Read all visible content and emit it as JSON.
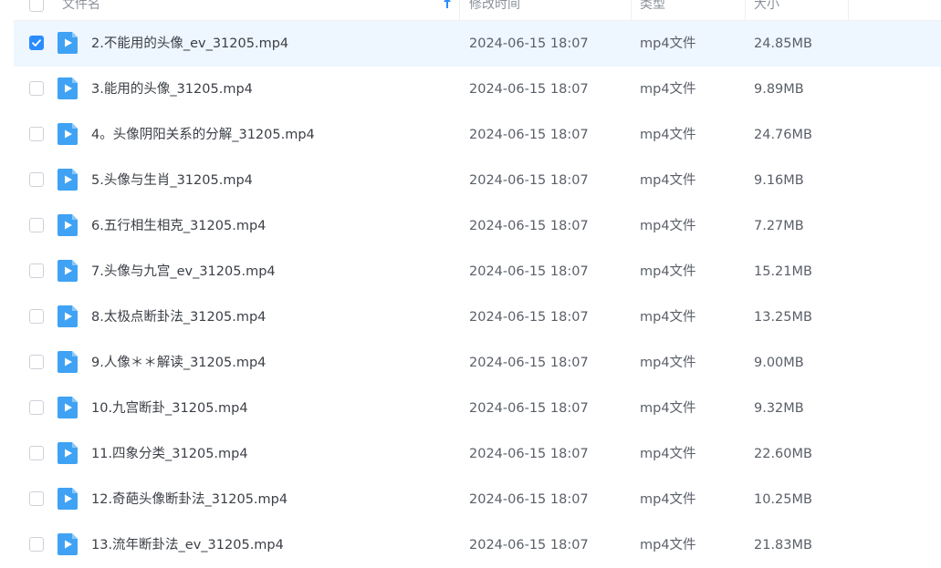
{
  "header": {
    "name_label": "文件名",
    "date_label": "修改时间",
    "type_label": "类型",
    "size_label": "大小",
    "sort_icon": "arrow-up-icon"
  },
  "colors": {
    "accent": "#2a8cff",
    "selected_row": "#eef6ff",
    "video_icon": "#3fa2f4"
  },
  "files": [
    {
      "name": "2.不能用的头像_ev_31205.mp4",
      "date": "2024-06-15 18:07",
      "type": "mp4文件",
      "size": "24.85MB",
      "checked": true
    },
    {
      "name": "3.能用的头像_31205.mp4",
      "date": "2024-06-15 18:07",
      "type": "mp4文件",
      "size": "9.89MB",
      "checked": false
    },
    {
      "name": "4。头像阴阳关系的分解_31205.mp4",
      "date": "2024-06-15 18:07",
      "type": "mp4文件",
      "size": "24.76MB",
      "checked": false
    },
    {
      "name": "5.头像与生肖_31205.mp4",
      "date": "2024-06-15 18:07",
      "type": "mp4文件",
      "size": "9.16MB",
      "checked": false
    },
    {
      "name": "6.五行相生相克_31205.mp4",
      "date": "2024-06-15 18:07",
      "type": "mp4文件",
      "size": "7.27MB",
      "checked": false
    },
    {
      "name": "7.头像与九宫_ev_31205.mp4",
      "date": "2024-06-15 18:07",
      "type": "mp4文件",
      "size": "15.21MB",
      "checked": false
    },
    {
      "name": "8.太极点断卦法_31205.mp4",
      "date": "2024-06-15 18:07",
      "type": "mp4文件",
      "size": "13.25MB",
      "checked": false
    },
    {
      "name": "9.人像＊＊解读_31205.mp4",
      "date": "2024-06-15 18:07",
      "type": "mp4文件",
      "size": "9.00MB",
      "checked": false
    },
    {
      "name": "10.九宫断卦_31205.mp4",
      "date": "2024-06-15 18:07",
      "type": "mp4文件",
      "size": "9.32MB",
      "checked": false
    },
    {
      "name": "11.四象分类_31205.mp4",
      "date": "2024-06-15 18:07",
      "type": "mp4文件",
      "size": "22.60MB",
      "checked": false
    },
    {
      "name": "12.奇葩头像断卦法_31205.mp4",
      "date": "2024-06-15 18:07",
      "type": "mp4文件",
      "size": "10.25MB",
      "checked": false
    },
    {
      "name": "13.流年断卦法_ev_31205.mp4",
      "date": "2024-06-15 18:07",
      "type": "mp4文件",
      "size": "21.83MB",
      "checked": false
    }
  ]
}
